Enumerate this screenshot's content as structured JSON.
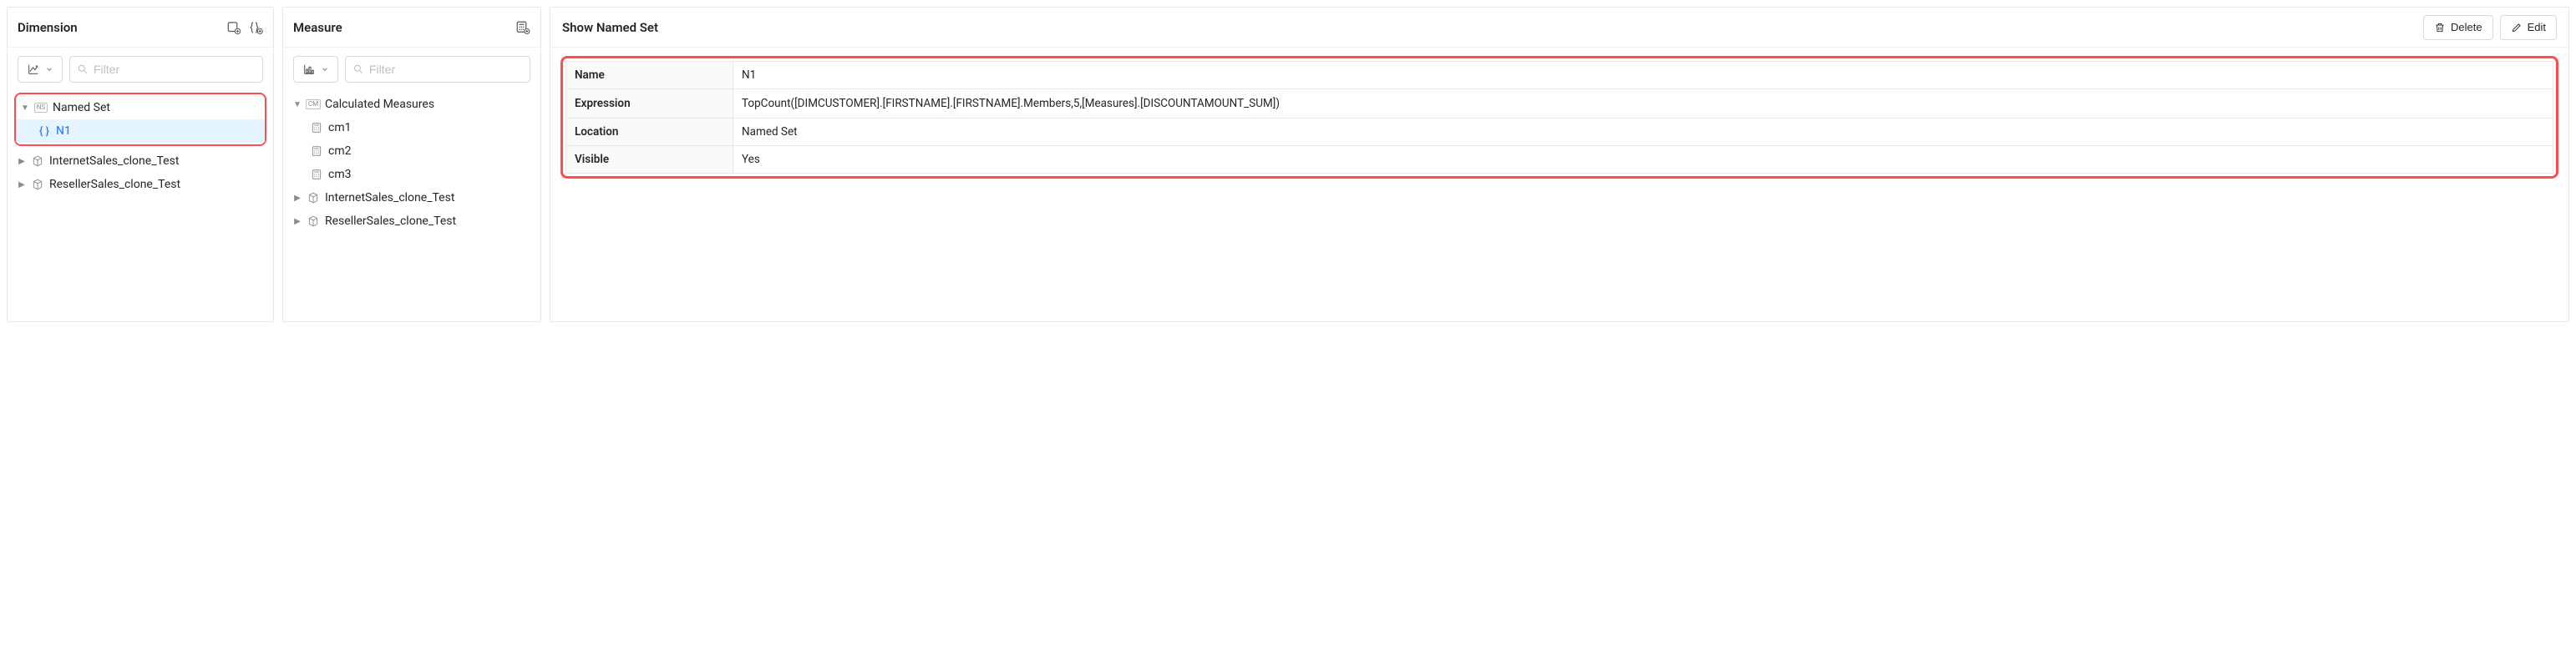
{
  "dimension": {
    "title": "Dimension",
    "filter_placeholder": "Filter",
    "tree": {
      "named_set": {
        "label": "Named Set",
        "children": [
          {
            "label": "N1"
          }
        ]
      },
      "cubes": [
        {
          "label": "InternetSales_clone_Test"
        },
        {
          "label": "ResellerSales_clone_Test"
        }
      ]
    }
  },
  "measure": {
    "title": "Measure",
    "filter_placeholder": "Filter",
    "tree": {
      "calc_group": {
        "label": "Calculated Measures",
        "children": [
          {
            "label": "cm1"
          },
          {
            "label": "cm2"
          },
          {
            "label": "cm3"
          }
        ]
      },
      "cubes": [
        {
          "label": "InternetSales_clone_Test"
        },
        {
          "label": "ResellerSales_clone_Test"
        }
      ]
    }
  },
  "detail": {
    "title": "Show Named Set",
    "delete_label": "Delete",
    "edit_label": "Edit",
    "rows": {
      "name": {
        "key": "Name",
        "value": "N1"
      },
      "expression": {
        "key": "Expression",
        "value": "TopCount([DIMCUSTOMER].[FIRSTNAME].[FIRSTNAME].Members,5,[Measures].[DISCOUNTAMOUNT_SUM])"
      },
      "location": {
        "key": "Location",
        "value": "Named Set"
      },
      "visible": {
        "key": "Visible",
        "value": "Yes"
      }
    }
  }
}
